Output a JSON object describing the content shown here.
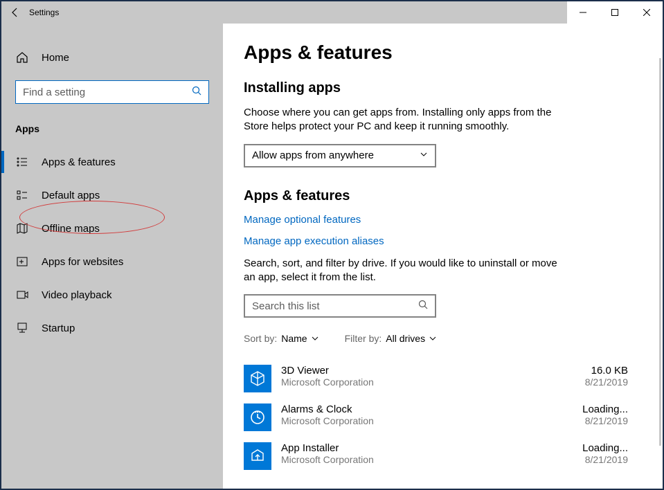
{
  "titlebar": {
    "title": "Settings"
  },
  "sidebar": {
    "home": "Home",
    "search_placeholder": "Find a setting",
    "group": "Apps",
    "items": [
      {
        "label": "Apps & features"
      },
      {
        "label": "Default apps"
      },
      {
        "label": "Offline maps"
      },
      {
        "label": "Apps for websites"
      },
      {
        "label": "Video playback"
      },
      {
        "label": "Startup"
      }
    ]
  },
  "main": {
    "heading": "Apps & features",
    "section1_title": "Installing apps",
    "section1_para": "Choose where you can get apps from. Installing only apps from the Store helps protect your PC and keep it running smoothly.",
    "select_value": "Allow apps from anywhere",
    "section2_title": "Apps & features",
    "link1": "Manage optional features",
    "link2": "Manage app execution aliases",
    "section2_para": "Search, sort, and filter by drive. If you would like to uninstall or move an app, select it from the list.",
    "search_placeholder": "Search this list",
    "sort_label": "Sort by:",
    "sort_value": "Name",
    "filter_label": "Filter by:",
    "filter_value": "All drives",
    "apps": [
      {
        "name": "3D Viewer",
        "publisher": "Microsoft Corporation",
        "size": "16.0 KB",
        "date": "8/21/2019"
      },
      {
        "name": "Alarms & Clock",
        "publisher": "Microsoft Corporation",
        "size": "Loading...",
        "date": "8/21/2019"
      },
      {
        "name": "App Installer",
        "publisher": "Microsoft Corporation",
        "size": "Loading...",
        "date": "8/21/2019"
      }
    ]
  }
}
